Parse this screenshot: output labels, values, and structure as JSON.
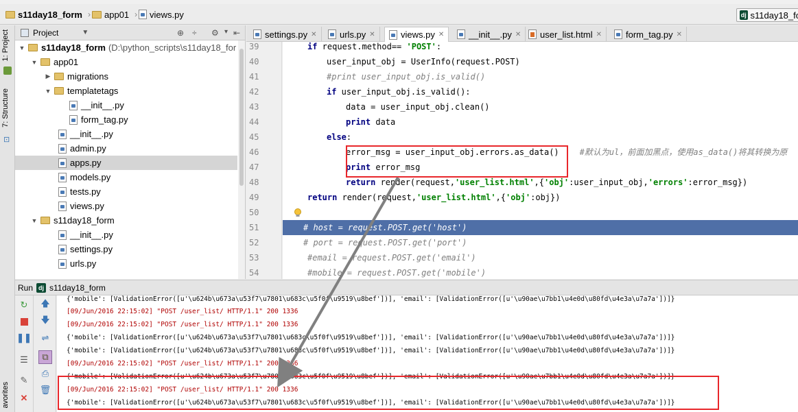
{
  "nav": {
    "project_crumb": "s11day18_form",
    "folder_crumb": "app01",
    "file_crumb": "views.py",
    "run_config": "s11day18_fo"
  },
  "side_tabs": {
    "project": "1: Project",
    "structure": "7: Structure",
    "favorites": "avorites"
  },
  "project_panel": {
    "title": "Project",
    "root_label": "s11day18_form",
    "root_path": "(D:\\python_scripts\\s11day18_for",
    "items": [
      {
        "label": "app01"
      },
      {
        "label": "migrations"
      },
      {
        "label": "templatetags"
      },
      {
        "label": "__init__.py"
      },
      {
        "label": "form_tag.py"
      },
      {
        "label": "__init__.py"
      },
      {
        "label": "admin.py"
      },
      {
        "label": "apps.py"
      },
      {
        "label": "models.py"
      },
      {
        "label": "tests.py"
      },
      {
        "label": "views.py"
      },
      {
        "label": "s11day18_form"
      },
      {
        "label": "__init__.py"
      },
      {
        "label": "settings.py"
      },
      {
        "label": "urls.py"
      }
    ]
  },
  "editor": {
    "tabs": [
      {
        "label": "settings.py"
      },
      {
        "label": "urls.py"
      },
      {
        "label": "views.py"
      },
      {
        "label": "__init__.py"
      },
      {
        "label": "user_list.html"
      },
      {
        "label": "form_tag.py"
      }
    ],
    "line_numbers": [
      "39",
      "40",
      "41",
      "42",
      "43",
      "44",
      "45",
      "46",
      "47",
      "48",
      "49",
      "50",
      "51",
      "52",
      "53",
      "54"
    ],
    "code": {
      "l39_a": "if",
      "l39_b": " request.method== ",
      "l39_c": "'POST'",
      "l39_d": ":",
      "l40": "user_input_obj = UserInfo(request.POST)",
      "l41": "#print user_input_obj.is_valid()",
      "l42_a": "if",
      "l42_b": " user_input_obj.is_valid():",
      "l43": "data = user_input_obj.clean()",
      "l44_a": "print",
      "l44_b": " data",
      "l45_a": "else",
      "l45_b": ":",
      "l46_a": "error_msg = user_input_obj.errors.as_data()",
      "l46_b": "#默认为ul，前面加黑点，使用as_data()将其转换为原",
      "l47_a": "print",
      "l47_b": " error_msg",
      "l48_a": "return",
      "l48_b": " render(request,",
      "l48_c": "'user_list.html'",
      "l48_d": ",{",
      "l48_e": "'obj'",
      "l48_f": ":user_input_obj,",
      "l48_g": "'errors'",
      "l48_h": ":error_msg})",
      "l49_a": "return",
      "l49_b": " render(request,",
      "l49_c": "'user_list.html'",
      "l49_d": ",{",
      "l49_e": "'obj'",
      "l49_f": ":obj})",
      "l51": "# host = request.POST.get('host')",
      "l52": "# port = request.POST.get('port')",
      "l53": "#email = request.POST.get('email')",
      "l54": "#mobile = request.POST.get('mobile')"
    }
  },
  "run": {
    "label": "Run",
    "config": "s11day18_form",
    "output": [
      "{'mobile': [ValidationError([u'\\u624b\\u673a\\u53f7\\u7801\\u683c\\u5f0f\\u9519\\u8bef'])], 'email': [ValidationError([u'\\u90ae\\u7bb1\\u4e0d\\u80fd\\u4e3a\\u7a7a'])]}",
      "[09/Jun/2016 22:15:02] \"POST /user_list/ HTTP/1.1\" 200 1336",
      "[09/Jun/2016 22:15:02] \"POST /user_list/ HTTP/1.1\" 200 1336",
      "{'mobile': [ValidationError([u'\\u624b\\u673a\\u53f7\\u7801\\u683c\\u5f0f\\u9519\\u8bef'])], 'email': [ValidationError([u'\\u90ae\\u7bb1\\u4e0d\\u80fd\\u4e3a\\u7a7a'])]}",
      "{'mobile': [ValidationError([u'\\u624b\\u673a\\u53f7\\u7801\\u683c\\u5f0f\\u9519\\u8bef'])], 'email': [ValidationError([u'\\u90ae\\u7bb1\\u4e0d\\u80fd\\u4e3a\\u7a7a'])]}",
      "[09/Jun/2016 22:15:02] \"POST /user_list/ HTTP/1.1\" 200 1336",
      "{'mobile': [ValidationError([u'\\u624b\\u673a\\u53f7\\u7801\\u683c\\u5f0f\\u9519\\u8bef'])], 'email': [ValidationError([u'\\u90ae\\u7bb1\\u4e0d\\u80fd\\u4e3a\\u7a7a'])]}",
      "[09/Jun/2016 22:15:02] \"POST /user_list/ HTTP/1.1\" 200 1336",
      "{'mobile': [ValidationError([u'\\u624b\\u673a\\u53f7\\u7801\\u683c\\u5f0f\\u9519\\u8bef'])], 'email': [ValidationError([u'\\u90ae\\u7bb1\\u4e0d\\u80fd\\u4e3a\\u7a7a'])]}"
    ]
  },
  "colors": {
    "annotation_red": "#e8262a",
    "annotation_arrow": "#808080",
    "highlight_line": "#4f6fa7"
  }
}
